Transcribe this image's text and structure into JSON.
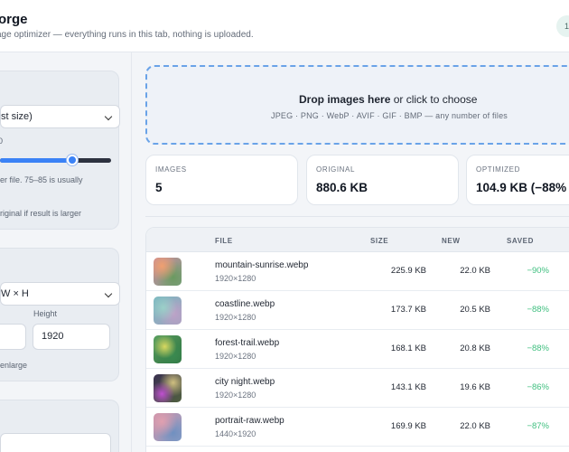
{
  "header": {
    "title": "orge",
    "subtitle": "age optimizer — everything runs in this tab, nothing is uploaded.",
    "badge": "1"
  },
  "sidebar": {
    "panel1": {
      "format_select": "st size)",
      "quality_tick": "0",
      "quality_level": 0.65,
      "hint": "er file. 75–85 is usually",
      "keep_original": "riginal if result is larger"
    },
    "panel2": {
      "resize_select": "W × H",
      "height_label": "Height",
      "width_value": "",
      "height_value": "1920",
      "enlarge_label": "enlarge"
    }
  },
  "dropzone": {
    "title": "Drop images here",
    "suffix": " or click to choose",
    "formats": "JPEG · PNG · WebP · AVIF · GIF · BMP — any number of files"
  },
  "stats": [
    {
      "label": "IMAGES",
      "value": "5"
    },
    {
      "label": "ORIGINAL",
      "value": "880.6 KB"
    },
    {
      "label": "OPTIMIZED",
      "value": "104.9 KB (−88%"
    }
  ],
  "table": {
    "headers": {
      "file": "FILE",
      "size": "SIZE",
      "new": "NEW",
      "saved": "SAVED"
    },
    "rows": [
      {
        "name": "mountain-sunrise.webp",
        "dims": "1920×1280",
        "size": "225.9 KB",
        "new": "22.0 KB",
        "saved": "−90%"
      },
      {
        "name": "coastline.webp",
        "dims": "1920×1280",
        "size": "173.7 KB",
        "new": "20.5 KB",
        "saved": "−88%"
      },
      {
        "name": "forest-trail.webp",
        "dims": "1920×1280",
        "size": "168.1 KB",
        "new": "20.8 KB",
        "saved": "−88%"
      },
      {
        "name": "city night.webp",
        "dims": "1920×1280",
        "size": "143.1 KB",
        "new": "19.6 KB",
        "saved": "−86%"
      },
      {
        "name": "portrait-raw.webp",
        "dims": "1440×1920",
        "size": "169.9 KB",
        "new": "22.0 KB",
        "saved": "−87%"
      }
    ]
  },
  "colors": {
    "accent": "#3b82f6",
    "saved_green": "#3fbf7f",
    "dropzone_border": "#6aa3e8"
  },
  "icons": {
    "select_chevron": "chevron-down-icon"
  }
}
